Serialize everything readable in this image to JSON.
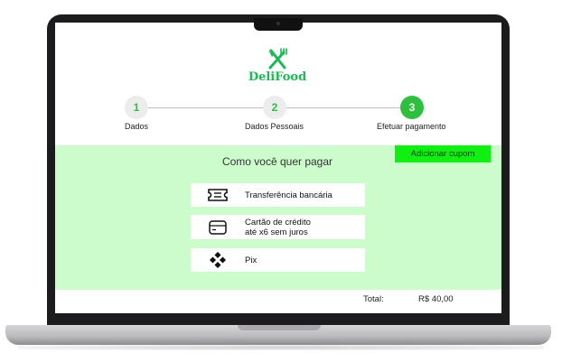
{
  "brand": {
    "name": "DeliFood",
    "icon": "fork-knife-icon",
    "color": "#1db954"
  },
  "steps": [
    {
      "number": "1",
      "label": "Dados",
      "state": "pending"
    },
    {
      "number": "2",
      "label": "Dados Pessoais",
      "state": "pending"
    },
    {
      "number": "3",
      "label": "Efetuar pagamento",
      "state": "active"
    }
  ],
  "payment": {
    "title": "Como você quer pagar",
    "coupon_label": "Adicionar cupom",
    "options": [
      {
        "icon": "ticket-icon",
        "label_line1": "Transferência bancária",
        "label_line2": ""
      },
      {
        "icon": "credit-card-icon",
        "label_line1": "Cartão de crédito",
        "label_line2": "até x6 sem juros"
      },
      {
        "icon": "pix-icon",
        "label_line1": "Pix",
        "label_line2": ""
      }
    ]
  },
  "footer": {
    "total_label": "Total:",
    "total_value": "R$ 40,00"
  },
  "colors": {
    "accent": "#2ebf3f",
    "panel": "#ccfccc",
    "coupon": "#11ee11"
  }
}
